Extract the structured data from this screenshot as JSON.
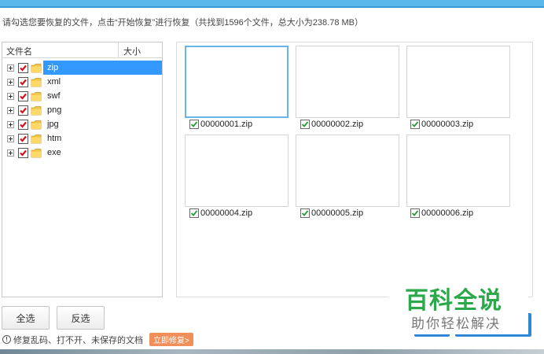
{
  "header": {
    "info": "请勾选您要恢复的文件，点击“开始恢复”进行恢复（共找到1596个文件，总大小为238.78 MB）"
  },
  "tree": {
    "columns": {
      "name": "文件名",
      "size": "大小"
    },
    "items": [
      {
        "label": "zip",
        "selected": true
      },
      {
        "label": "xml"
      },
      {
        "label": "swf"
      },
      {
        "label": "png"
      },
      {
        "label": "jpg"
      },
      {
        "label": "htm"
      },
      {
        "label": "exe"
      }
    ]
  },
  "files": [
    {
      "name": "00000001.zip"
    },
    {
      "name": "00000002.zip"
    },
    {
      "name": "00000003.zip"
    },
    {
      "name": "00000004.zip"
    },
    {
      "name": "00000005.zip"
    },
    {
      "name": "00000006.zip"
    }
  ],
  "buttons": {
    "select_all": "全选",
    "invert": "反选"
  },
  "footer": {
    "note": "修复乱码、打不开、未保存的文档",
    "repair_link": "立即修复>"
  },
  "watermark": {
    "main": "百科全说",
    "sub": "助你轻松解决"
  },
  "colors": {
    "accent": "#3399ff",
    "top_band": "#5bb8ea",
    "repair": "#f08f5a",
    "watermark_green": "#2aa84a"
  }
}
